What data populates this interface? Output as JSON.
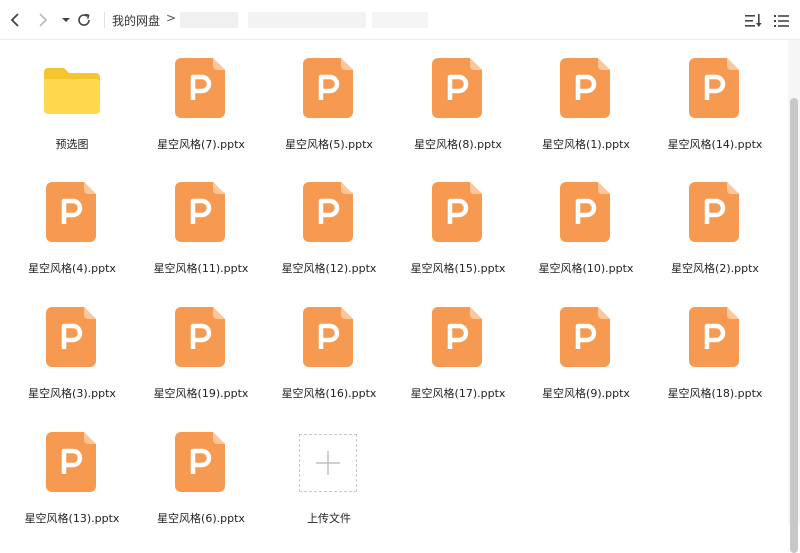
{
  "toolbar": {
    "breadcrumb_root": "我的网盘",
    "breadcrumb_separator": ">",
    "icons": [
      "back-icon",
      "forward-icon",
      "dropdown-icon",
      "refresh-icon",
      "sort-icon",
      "list-view-icon"
    ]
  },
  "files": [
    {
      "name": "预选图",
      "type": "folder"
    },
    {
      "name": "星空风格(7).pptx",
      "type": "pptx"
    },
    {
      "name": "星空风格(5).pptx",
      "type": "pptx"
    },
    {
      "name": "星空风格(8).pptx",
      "type": "pptx"
    },
    {
      "name": "星空风格(1).pptx",
      "type": "pptx"
    },
    {
      "name": "星空风格(14).pptx",
      "type": "pptx"
    },
    {
      "name": "星空风格(4).pptx",
      "type": "pptx"
    },
    {
      "name": "星空风格(11).pptx",
      "type": "pptx"
    },
    {
      "name": "星空风格(12).pptx",
      "type": "pptx"
    },
    {
      "name": "星空风格(15).pptx",
      "type": "pptx"
    },
    {
      "name": "星空风格(10).pptx",
      "type": "pptx"
    },
    {
      "name": "星空风格(2).pptx",
      "type": "pptx"
    },
    {
      "name": "星空风格(3).pptx",
      "type": "pptx"
    },
    {
      "name": "星空风格(19).pptx",
      "type": "pptx"
    },
    {
      "name": "星空风格(16).pptx",
      "type": "pptx"
    },
    {
      "name": "星空风格(17).pptx",
      "type": "pptx"
    },
    {
      "name": "星空风格(9).pptx",
      "type": "pptx"
    },
    {
      "name": "星空风格(18).pptx",
      "type": "pptx"
    },
    {
      "name": "星空风格(13).pptx",
      "type": "pptx"
    },
    {
      "name": "星空风格(6).pptx",
      "type": "pptx"
    }
  ],
  "upload": {
    "label": "上传文件"
  },
  "colors": {
    "pptx": "#f79a51",
    "pptx_fold": "#fbc79b",
    "folder": "#ffd84d",
    "folder_tab": "#f7c52e"
  }
}
